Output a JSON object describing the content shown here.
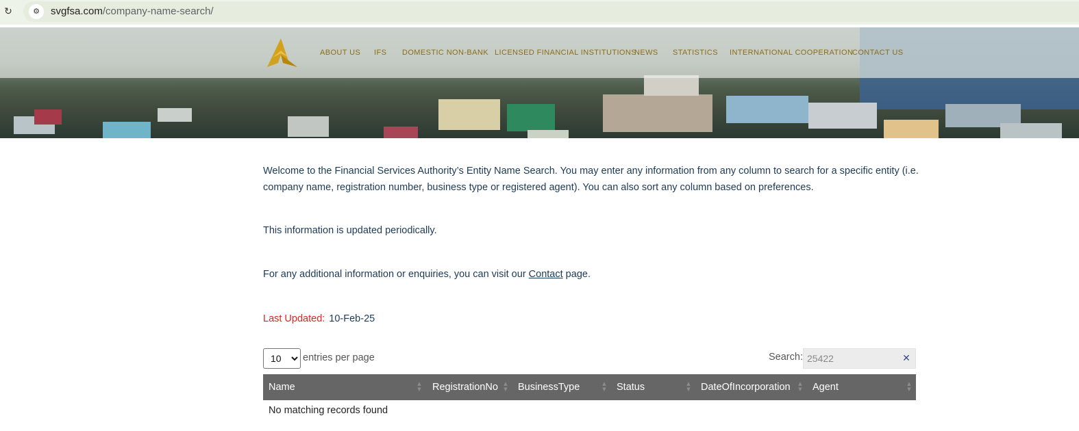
{
  "browser": {
    "url_host": "svgfsa.com",
    "url_path": "/company-name-search/",
    "reload_icon": "reload-icon",
    "site_info_icon": "site-info-icon"
  },
  "header": {
    "logo_icon": "fsa-logo-icon",
    "nav": [
      {
        "label": "ABOUT US"
      },
      {
        "label": "IFS"
      },
      {
        "label": "DOMESTIC NON-BANK"
      },
      {
        "label": "LICENSED FINANCIAL INSTITUTIONS"
      },
      {
        "label": "NEWS"
      },
      {
        "label": "STATISTICS"
      },
      {
        "label": "INTERNATIONAL COOPERATION"
      },
      {
        "label": "CONTACT US"
      }
    ],
    "nav_color": "#8a6d14"
  },
  "content": {
    "intro": "Welcome to the Financial Services Authority’s Entity Name Search. You may enter any information from any column to search for a specific entity (i.e. company name, registration number, business type or registered agent). You can also sort any column based on preferences.",
    "updated_note": "This information is updated periodically.",
    "enquiry_prefix": "For any additional information or enquiries, you can visit our ",
    "enquiry_link": "Contact",
    "enquiry_suffix": " page.",
    "last_updated_label": "Last Updated:",
    "last_updated_value": "10-Feb-25",
    "last_updated_color": "#e0261e"
  },
  "table_controls": {
    "page_size_selected": "10",
    "page_size_label": "entries per page",
    "search_label": "Search:",
    "search_value": "25422",
    "clear_icon": "clear-icon"
  },
  "table": {
    "columns": [
      "Name",
      "RegistrationNo",
      "BusinessType",
      "Status",
      "DateOfIncorporation",
      "Agent"
    ],
    "sort_icon": "sort-icon",
    "empty_message": "No matching records found",
    "header_color": "#666666"
  }
}
